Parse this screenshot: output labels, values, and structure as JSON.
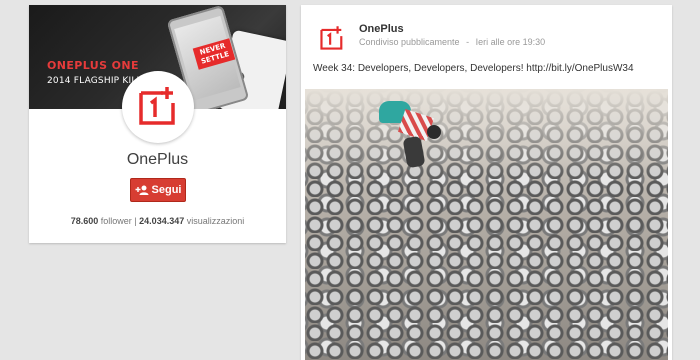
{
  "profile": {
    "cover": {
      "line1": "ONEPLUS ONE",
      "line2": "2014 FLAGSHIP KILLER",
      "phone_badge": "NEVER SETTLE"
    },
    "name": "OnePlus",
    "follow_label": "Segui",
    "followers_count": "78.600",
    "followers_label": "follower",
    "separator": "|",
    "views_count": "24.034.347",
    "views_label": "visualizzazioni"
  },
  "post": {
    "author": "OnePlus",
    "visibility": "Condiviso pubblicamente",
    "dot": "-",
    "time": "Ieri alle ore 19:30",
    "text": "Week 34: Developers, Developers, Developers! http://bit.ly/OnePlusW34"
  },
  "colors": {
    "brand_red": "#e62b2b",
    "follow_button": "#d73d32",
    "page_background": "#e5e5e5"
  },
  "icons": {
    "logo": "oneplus-logo-icon",
    "follow": "add-person-icon"
  }
}
